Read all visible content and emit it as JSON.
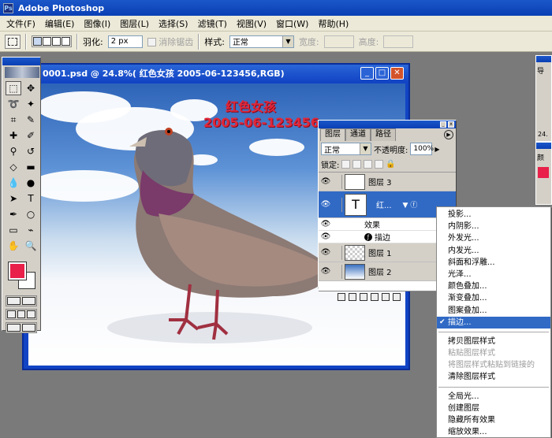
{
  "app": {
    "title": "Adobe Photoshop"
  },
  "menu": [
    "文件(F)",
    "编辑(E)",
    "图像(I)",
    "图层(L)",
    "选择(S)",
    "滤镜(T)",
    "视图(V)",
    "窗口(W)",
    "帮助(H)"
  ],
  "options": {
    "feather_label": "羽化:",
    "feather_value": "2 px",
    "antialias_label": "消除锯齿",
    "style_label": "样式:",
    "style_value": "正常",
    "width_label": "宽度:",
    "height_label": "高度:"
  },
  "document": {
    "title": "0001.psd @ 24.8%(  红色女孩 2005-06-123456,RGB)",
    "image_title": "红色女孩",
    "image_subtitle": "2005-06-123456"
  },
  "layers_panel": {
    "tabs": [
      "图层",
      "通道",
      "路径"
    ],
    "blend_mode": "正常",
    "opacity_label": "不透明度:",
    "opacity_value": "100%",
    "lock_label": "锁定:",
    "layers": [
      {
        "name": "图层 3"
      },
      {
        "name": "红...",
        "text_layer": "T"
      },
      {
        "name": "图层 1"
      },
      {
        "name": "图层 2"
      }
    ],
    "effects_label": "效果",
    "stroke_label": "描边"
  },
  "context_menu": {
    "group1": [
      "投影...",
      "内阴影...",
      "外发光...",
      "内发光...",
      "斜面和浮雕...",
      "光泽...",
      "颜色叠加...",
      "渐变叠加...",
      "图案叠加...",
      "描边..."
    ],
    "group2": [
      {
        "label": "拷贝图层样式",
        "disabled": false
      },
      {
        "label": "粘贴图层样式",
        "disabled": true
      },
      {
        "label": "将图层样式粘贴到链接的",
        "disabled": true
      },
      {
        "label": "清除图层样式",
        "disabled": false
      }
    ],
    "group3": [
      "全局光...",
      "创建图层",
      "隐藏所有效果",
      "缩放效果..."
    ],
    "checked_item": "描边..."
  },
  "right_panel": {
    "value": "24."
  },
  "colors": {
    "foreground": "#e8204a",
    "background": "#ffffff",
    "accent": "#316ac5"
  }
}
